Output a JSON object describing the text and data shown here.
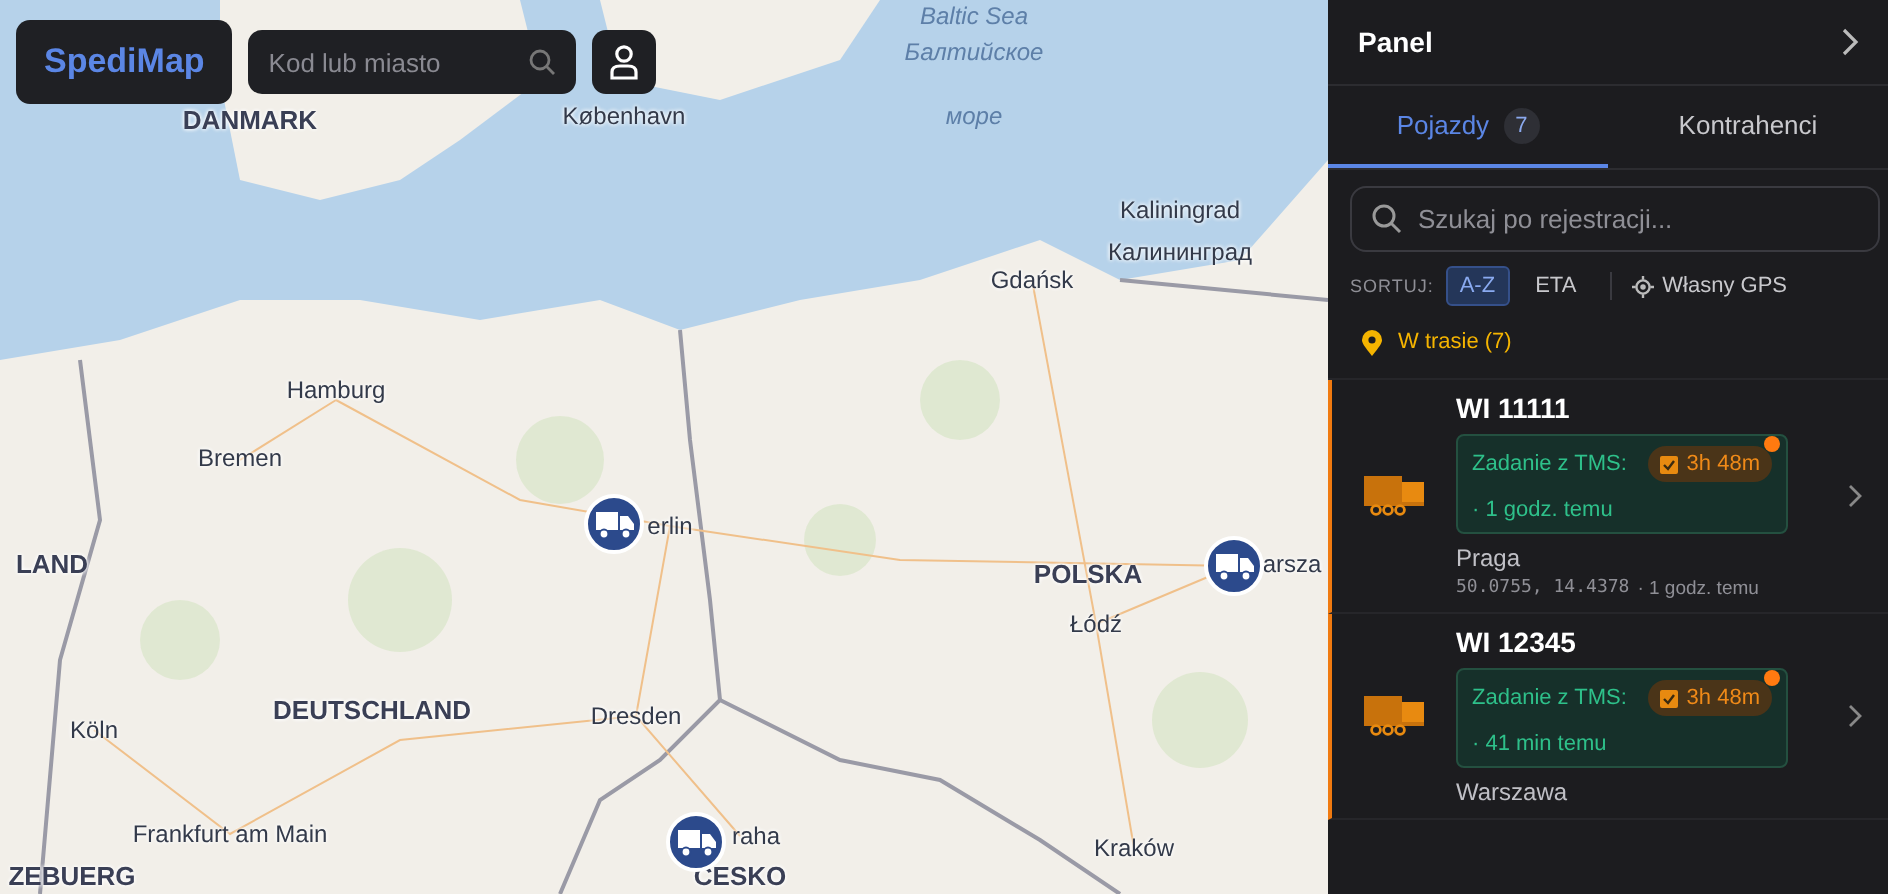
{
  "header": {
    "logo": "SpediMap",
    "search": {
      "placeholder": "Kod lub miasto"
    }
  },
  "map": {
    "labels": [
      {
        "text": "Baltic Sea",
        "kind": "sea"
      },
      {
        "text": "Балтийское",
        "kind": "sea"
      },
      {
        "text": "DANMARK",
        "kind": "country"
      },
      {
        "text": "København",
        "kind": "city"
      },
      {
        "text": "море",
        "kind": "sea"
      },
      {
        "text": "Kaliningrad",
        "kind": "city"
      },
      {
        "text": "Калининград",
        "kind": "city"
      },
      {
        "text": "Gdańsk",
        "kind": "city"
      },
      {
        "text": "Hamburg",
        "kind": "city"
      },
      {
        "text": "Bremen",
        "kind": "city"
      },
      {
        "text": "erlin",
        "kind": "city"
      },
      {
        "text": "POLSKA",
        "kind": "country"
      },
      {
        "text": "arsza",
        "kind": "city"
      },
      {
        "text": "Łódź",
        "kind": "city"
      },
      {
        "text": "LAND",
        "kind": "country"
      },
      {
        "text": "DEUTSCHLAND",
        "kind": "country"
      },
      {
        "text": "Dresden",
        "kind": "city"
      },
      {
        "text": "Köln",
        "kind": "city"
      },
      {
        "text": "Frankfurt am Main",
        "kind": "city"
      },
      {
        "text": "raha",
        "kind": "city"
      },
      {
        "text": "Kraków",
        "kind": "city"
      },
      {
        "text": "ZEBUERG",
        "kind": "country"
      },
      {
        "text": "ČESKO",
        "kind": "country"
      }
    ]
  },
  "panel": {
    "title": "Panel",
    "tabs": [
      {
        "label": "Pojazdy",
        "count": "7",
        "selected": true
      },
      {
        "label": "Kontrahenci",
        "selected": false
      }
    ],
    "search": {
      "placeholder": "Szukaj po rejestracji..."
    },
    "sort": {
      "label": "SORTUJ:",
      "options": [
        {
          "label": "A-Z",
          "selected": true
        },
        {
          "label": "ETA",
          "selected": false
        }
      ],
      "gps_label": "Własny GPS"
    },
    "group": {
      "label": "W trasie (7)"
    },
    "vehicles": [
      {
        "plate": "WI 11111",
        "task_label": "Zadanie z TMS:",
        "duration": "3h 48m",
        "alert": true,
        "updated": "· 1 godz. temu",
        "location": "Praga",
        "coords": "50.0755, 14.4378",
        "coords_updated": "· 1 godz. temu"
      },
      {
        "plate": "WI 12345",
        "task_label": "Zadanie z TMS:",
        "duration": "3h 48m",
        "alert": true,
        "updated": "· 41 min temu",
        "location": "Warszawa"
      }
    ]
  }
}
